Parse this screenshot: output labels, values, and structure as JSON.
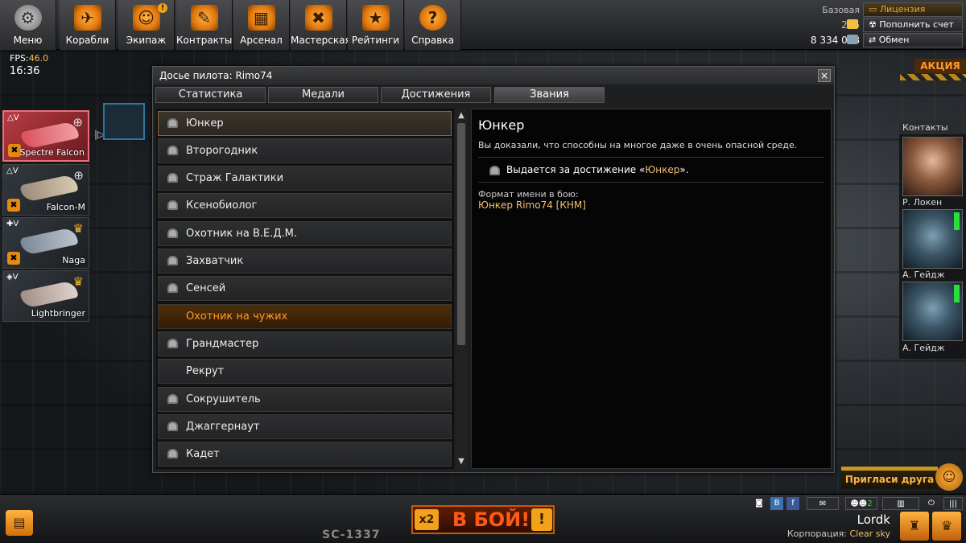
{
  "nav": [
    {
      "label": "Меню",
      "icon": "gear-icon",
      "glyph": "⚙"
    },
    {
      "label": "Корабли",
      "icon": "ships-icon",
      "glyph": "✈"
    },
    {
      "label": "Экипаж",
      "icon": "crew-icon",
      "glyph": "☺"
    },
    {
      "label": "Контракты",
      "icon": "contracts-icon",
      "glyph": "✎"
    },
    {
      "label": "Арсенал",
      "icon": "arsenal-icon",
      "glyph": "▦"
    },
    {
      "label": "Мастерская",
      "icon": "workshop-icon",
      "glyph": "✖"
    },
    {
      "label": "Рейтинги",
      "icon": "ratings-icon",
      "glyph": "★"
    },
    {
      "label": "Справка",
      "icon": "help-icon",
      "glyph": "?"
    }
  ],
  "currency": {
    "base_label": "Базовая",
    "gold": "205",
    "credits": "8 334 058",
    "license": "Лицензия",
    "topup": "Пополнить счет",
    "exchange": "Обмен"
  },
  "hud": {
    "fps_label": "FPS:",
    "fps": "46.0",
    "time": "16:36"
  },
  "ships": [
    {
      "name": "Spectre Falcon",
      "tier": "V"
    },
    {
      "name": "Falcon-M",
      "tier": "V"
    },
    {
      "name": "Naga",
      "tier": "V"
    },
    {
      "name": "Lightbringer",
      "tier": "V"
    }
  ],
  "dialog": {
    "title": "Досье пилота: Rimo74",
    "close": "×",
    "tabs": [
      "Статистика",
      "Медали",
      "Достижения",
      "Звания"
    ],
    "active_tab": "Звания",
    "ranks": [
      {
        "label": "Юнкер",
        "locked": true
      },
      {
        "label": "Второгодник",
        "locked": true
      },
      {
        "label": "Страж Галактики",
        "locked": true
      },
      {
        "label": "Ксенобиолог",
        "locked": true
      },
      {
        "label": "Охотник на В.Е.Д.М.",
        "locked": true
      },
      {
        "label": "Захватчик",
        "locked": true
      },
      {
        "label": "Сенсей",
        "locked": true
      },
      {
        "label": "Охотник на чужих",
        "locked": false
      },
      {
        "label": "Грандмастер",
        "locked": true
      },
      {
        "label": "Рекрут",
        "locked": false
      },
      {
        "label": "Сокрушитель",
        "locked": true
      },
      {
        "label": "Джаггернаут",
        "locked": true
      },
      {
        "label": "Кадет",
        "locked": true
      }
    ],
    "detail": {
      "title": "Юнкер",
      "desc": "Вы доказали, что способны на многое даже в очень опасной среде.",
      "award_prefix": "Выдается за достижение «",
      "award_name": "Юнкер",
      "award_suffix": "».",
      "format_label": "Формат имени в бою:",
      "format_value": "Юнкер Rimo74 [КНМ]"
    }
  },
  "promo": "АКЦИЯ",
  "contacts": {
    "header": "Контакты",
    "items": [
      {
        "name": "Р. Локен"
      },
      {
        "name": "А. Гейдж"
      },
      {
        "name": "А. Гейдж"
      }
    ]
  },
  "invite": "Пригласи друга",
  "bottom": {
    "battle": "В БОЙ!",
    "x2": "x2",
    "warn": "!",
    "hull": "SC-1337",
    "player": "Lordk",
    "corp_label": "Корпорация:",
    "corp": "Clear sky",
    "squad_count": "2"
  }
}
